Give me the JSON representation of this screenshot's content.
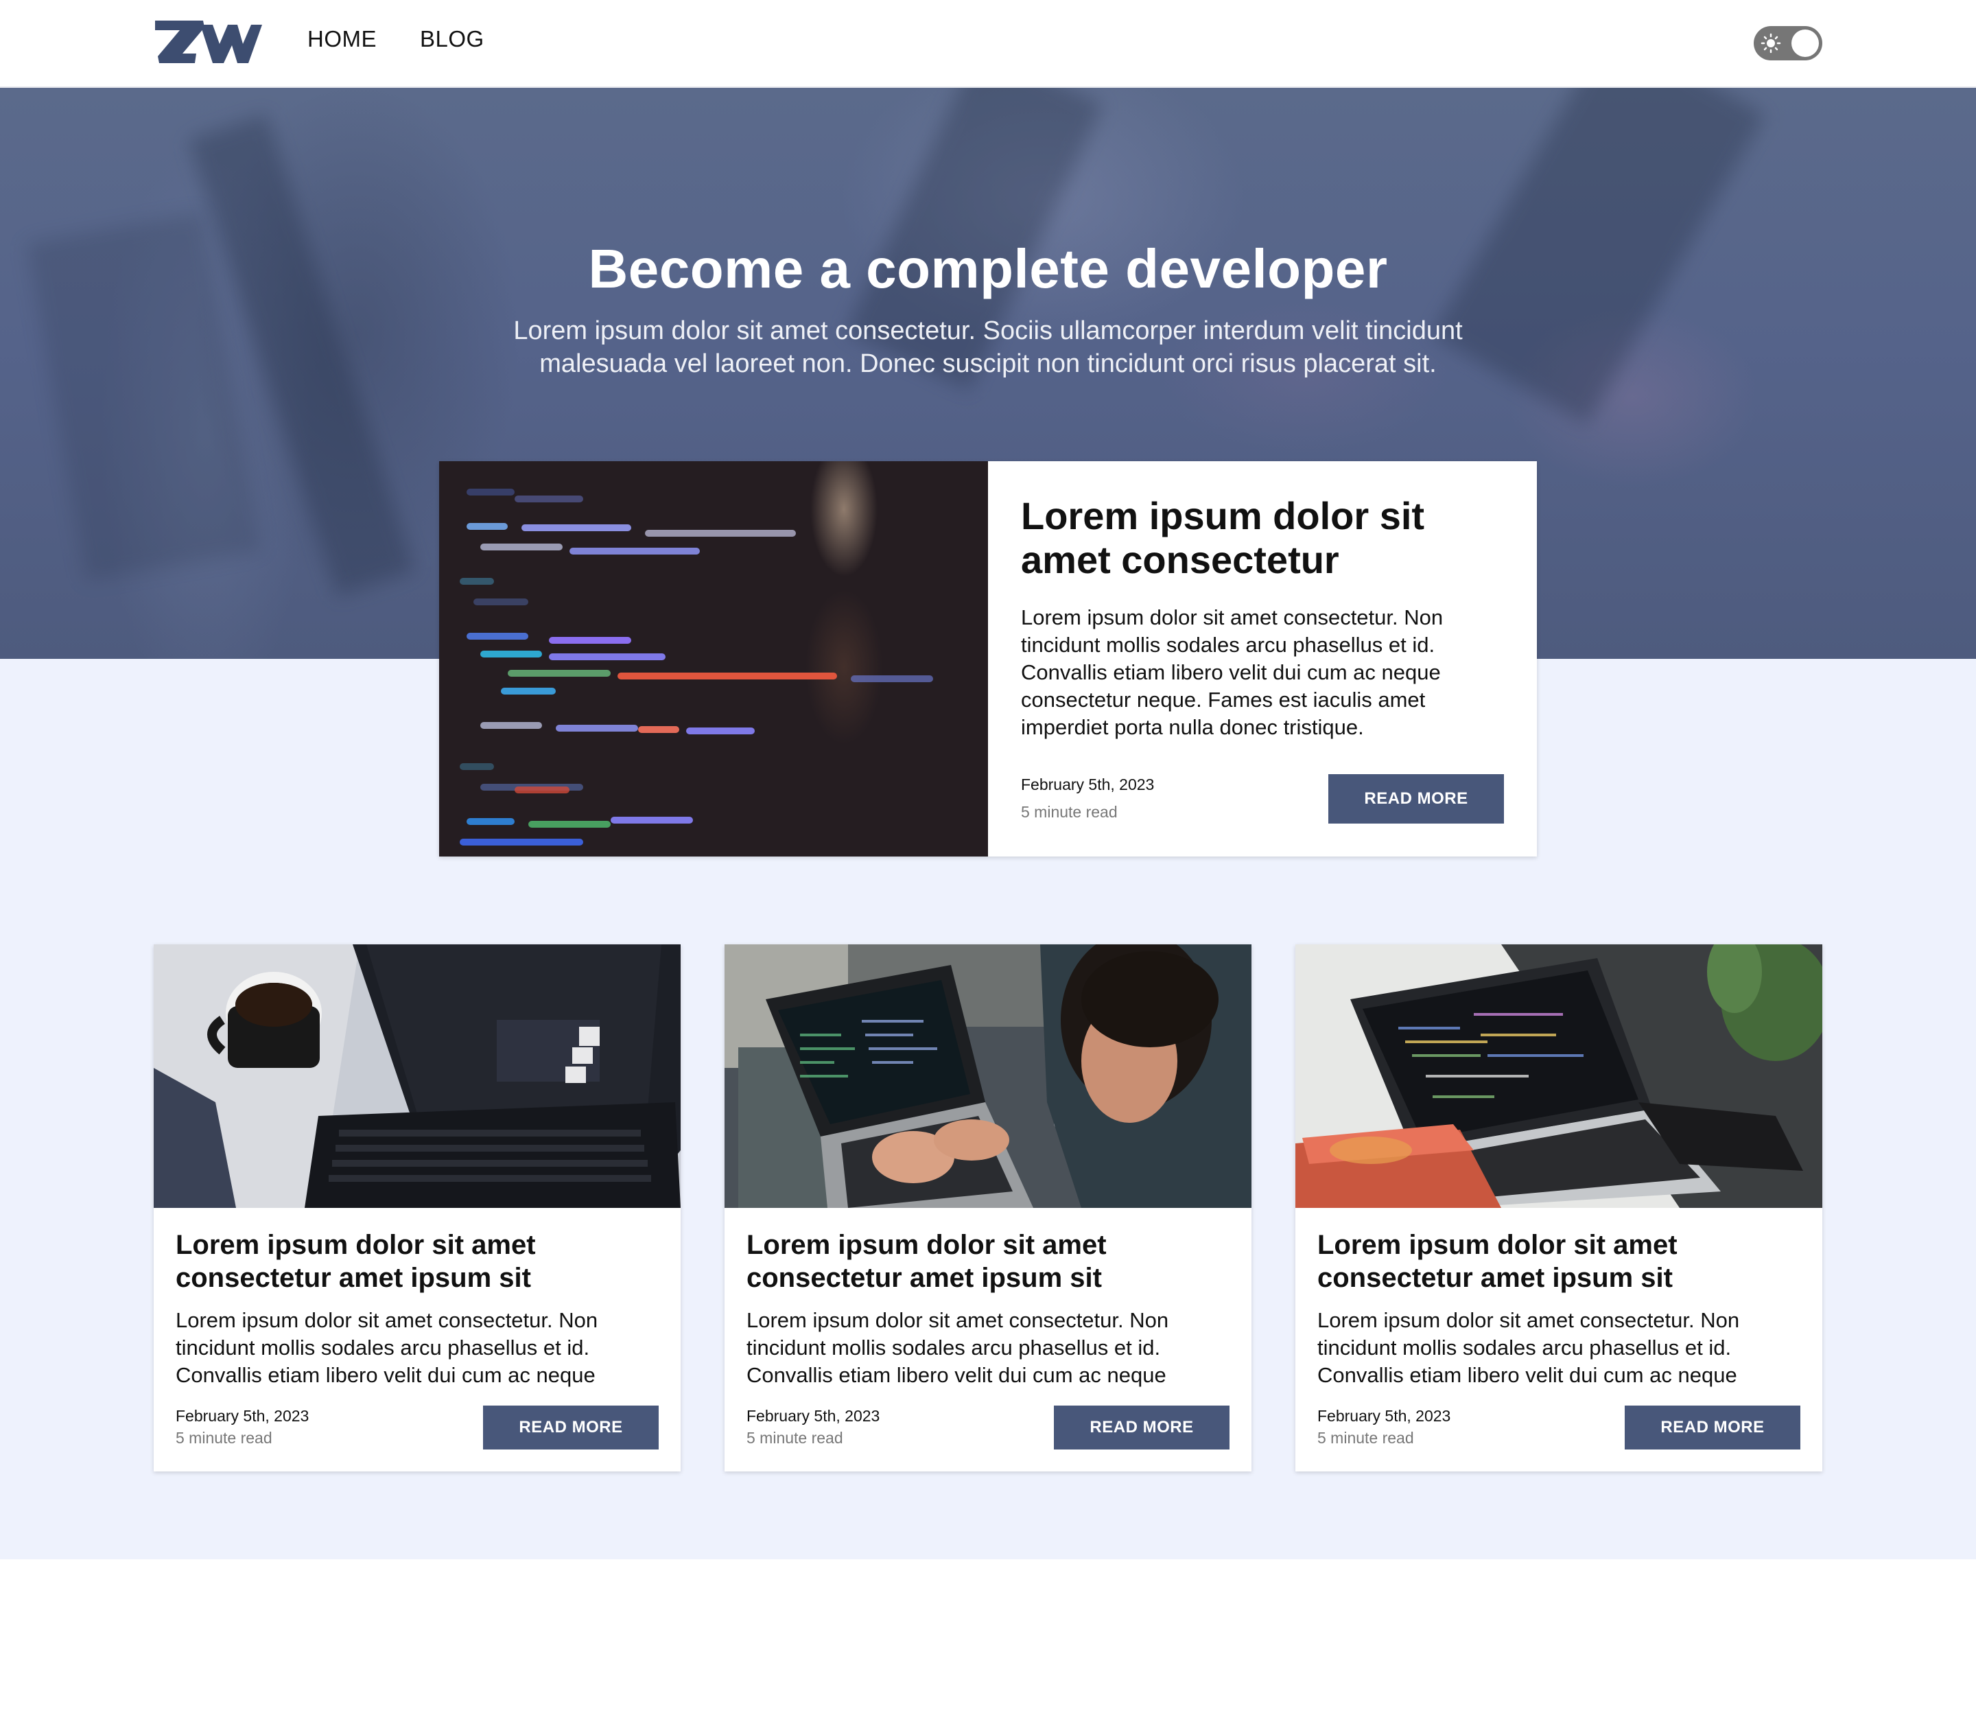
{
  "nav": {
    "home": "HOME",
    "blog": "BLOG"
  },
  "icons": {
    "logo": "zw-logo",
    "theme_toggle": "sun-icon"
  },
  "colors": {
    "accent": "#48577a",
    "hero_bg": "#55638a",
    "section_bg": "#eef2fd"
  },
  "hero": {
    "title": "Become a complete developer",
    "subtitle": "Lorem ipsum dolor sit amet consectetur. Sociis ullamcorper interdum velit tincidunt malesuada vel laoreet non. Donec suscipit non tincidunt orci risus placerat sit."
  },
  "featured": {
    "title": "Lorem ipsum dolor sit amet consectetur",
    "text": "Lorem ipsum dolor sit amet consectetur. Non tincidunt mollis sodales arcu phasellus et id. Convallis etiam libero velit dui cum ac neque consectetur neque. Fames est iaculis amet imperdiet porta nulla donec tristique.",
    "date": "February 5th, 2023",
    "read_time": "5 minute read",
    "button": "READ MORE"
  },
  "cards": [
    {
      "title": "Lorem ipsum dolor sit amet consectetur amet ipsum sit",
      "text": "Lorem ipsum dolor sit amet consectetur. Non tincidunt mollis sodales arcu phasellus et id. Convallis etiam libero velit dui cum ac neque",
      "date": "February 5th, 2023",
      "read_time": "5 minute read",
      "button": "READ MORE"
    },
    {
      "title": "Lorem ipsum dolor sit amet consectetur amet ipsum sit",
      "text": "Lorem ipsum dolor sit amet consectetur. Non tincidunt mollis sodales arcu phasellus et id. Convallis etiam libero velit dui cum ac neque",
      "date": "February 5th, 2023",
      "read_time": "5 minute read",
      "button": "READ MORE"
    },
    {
      "title": "Lorem ipsum dolor sit amet consectetur amet ipsum sit",
      "text": "Lorem ipsum dolor sit amet consectetur. Non tincidunt mollis sodales arcu phasellus et id. Convallis etiam libero velit dui cum ac neque",
      "date": "February 5th, 2023",
      "read_time": "5 minute read",
      "button": "READ MORE"
    }
  ]
}
